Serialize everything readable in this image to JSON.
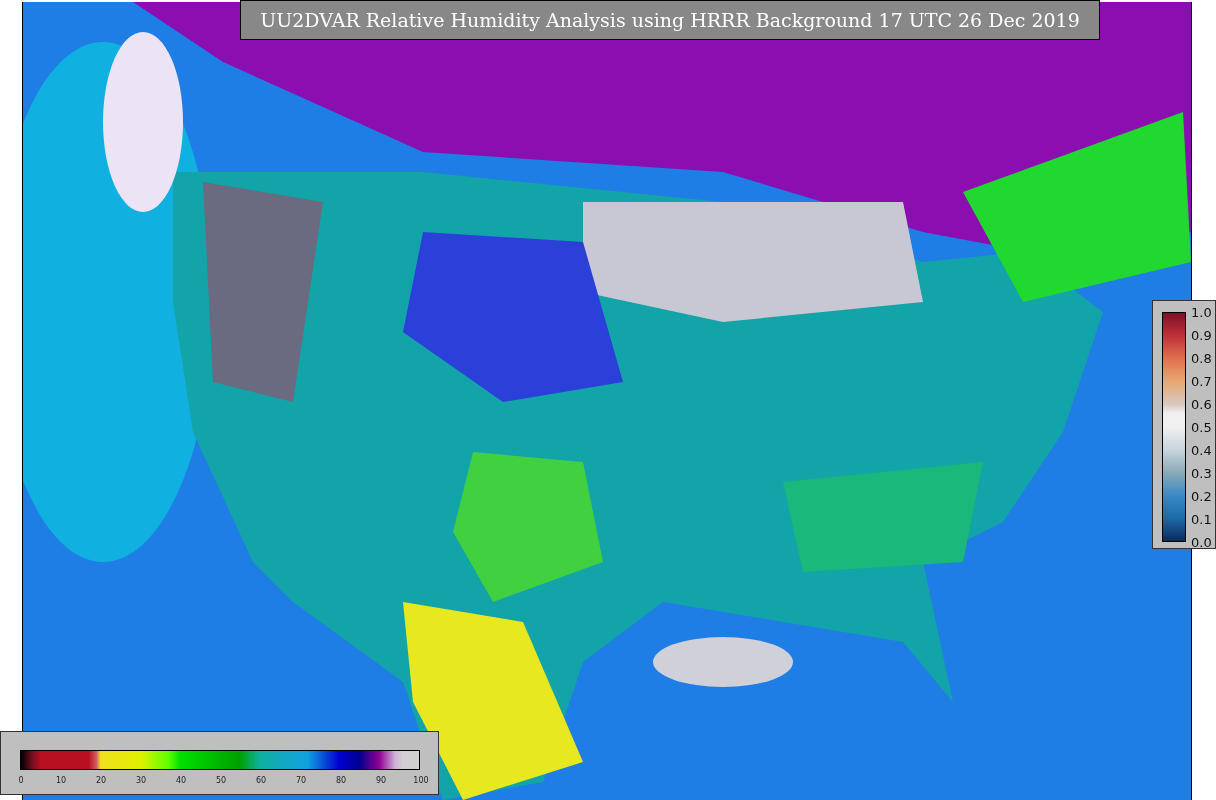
{
  "title": "UU2DVAR Relative Humidity Analysis using HRRR Background 17 UTC 26 Dec 2019",
  "humidity_colorbar": {
    "ticks": [
      "0",
      "10",
      "20",
      "30",
      "40",
      "50",
      "60",
      "70",
      "80",
      "90",
      "100"
    ]
  },
  "observation_colorbar": {
    "ticks": [
      "1.0",
      "0.9",
      "0.8",
      "0.7",
      "0.6",
      "0.5",
      "0.4",
      "0.3",
      "0.2",
      "0.1",
      "0.0"
    ]
  }
}
